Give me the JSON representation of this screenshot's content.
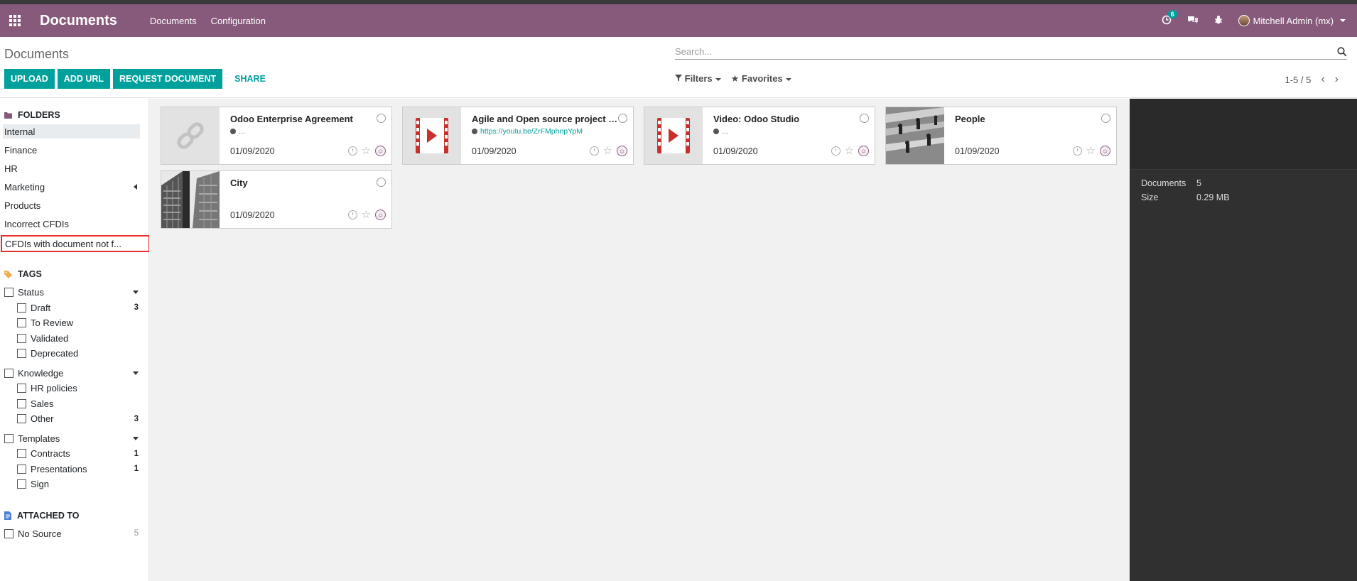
{
  "navbar": {
    "brand": "Documents",
    "menu": [
      "Documents",
      "Configuration"
    ],
    "activity_count": "6",
    "user": "Mitchell Admin (mx)"
  },
  "control_panel": {
    "breadcrumb": "Documents",
    "search_placeholder": "Search...",
    "buttons": {
      "upload": "UPLOAD",
      "add_url": "ADD URL",
      "request": "REQUEST DOCUMENT",
      "share": "SHARE"
    },
    "filters": "Filters",
    "favorites": "Favorites",
    "pager": "1-5 / 5"
  },
  "sidebar": {
    "folders_title": "FOLDERS",
    "folders": [
      "Internal",
      "Finance",
      "HR",
      "Marketing",
      "Products",
      "Incorrect CFDIs",
      "CFDIs with document not f..."
    ],
    "tags_title": "TAGS",
    "tag_groups": [
      {
        "name": "Status",
        "items": [
          {
            "label": "Draft",
            "count": "3"
          },
          {
            "label": "To Review",
            "count": ""
          },
          {
            "label": "Validated",
            "count": ""
          },
          {
            "label": "Deprecated",
            "count": ""
          }
        ]
      },
      {
        "name": "Knowledge",
        "items": [
          {
            "label": "HR policies",
            "count": ""
          },
          {
            "label": "Sales",
            "count": ""
          },
          {
            "label": "Other",
            "count": "3"
          }
        ]
      },
      {
        "name": "Templates",
        "items": [
          {
            "label": "Contracts",
            "count": "1"
          },
          {
            "label": "Presentations",
            "count": "1"
          },
          {
            "label": "Sign",
            "count": ""
          }
        ]
      }
    ],
    "attached_title": "ATTACHED TO",
    "attached": [
      {
        "label": "No Source",
        "count": "5"
      }
    ]
  },
  "documents": [
    {
      "name": "Odoo Enterprise Agreement",
      "sub": "...",
      "date": "01/09/2020",
      "thumb": "link-icon"
    },
    {
      "name": "Agile and Open source project m...",
      "sub": "https://youtu.be/ZrFMphnpYpM",
      "date": "01/09/2020",
      "thumb": "video-icon"
    },
    {
      "name": "Video: Odoo Studio",
      "sub": "...",
      "date": "01/09/2020",
      "thumb": "video-icon"
    },
    {
      "name": "People",
      "sub": "",
      "date": "01/09/2020",
      "thumb": "photo-people"
    },
    {
      "name": "City",
      "sub": "",
      "date": "01/09/2020",
      "thumb": "photo-city"
    }
  ],
  "inspector": {
    "documents_label": "Documents",
    "documents_value": "5",
    "size_label": "Size",
    "size_value": "0.29 MB"
  }
}
